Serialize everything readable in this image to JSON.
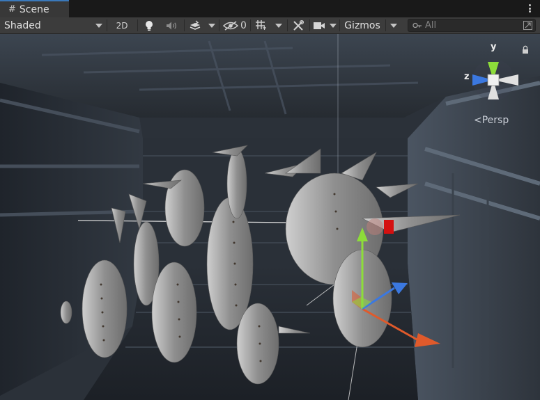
{
  "tab": {
    "icon": "hash-icon",
    "label": "Scene"
  },
  "toolbar": {
    "shading_mode": "Shaded",
    "mode_2d_label": "2D",
    "hidden_count": "0",
    "gizmos_label": "Gizmos",
    "search_placeholder": "All"
  },
  "orientation_gizmo": {
    "y_label": "y",
    "z_label": "z",
    "projection_label": "Persp"
  },
  "colors": {
    "tab_accent": "#3a79bb",
    "axis_x": "#e05a2b",
    "axis_y": "#8ddc3a",
    "axis_z": "#3b78e0",
    "toolbar_bg": "#3c3c3c",
    "tab_bg": "#383838"
  }
}
